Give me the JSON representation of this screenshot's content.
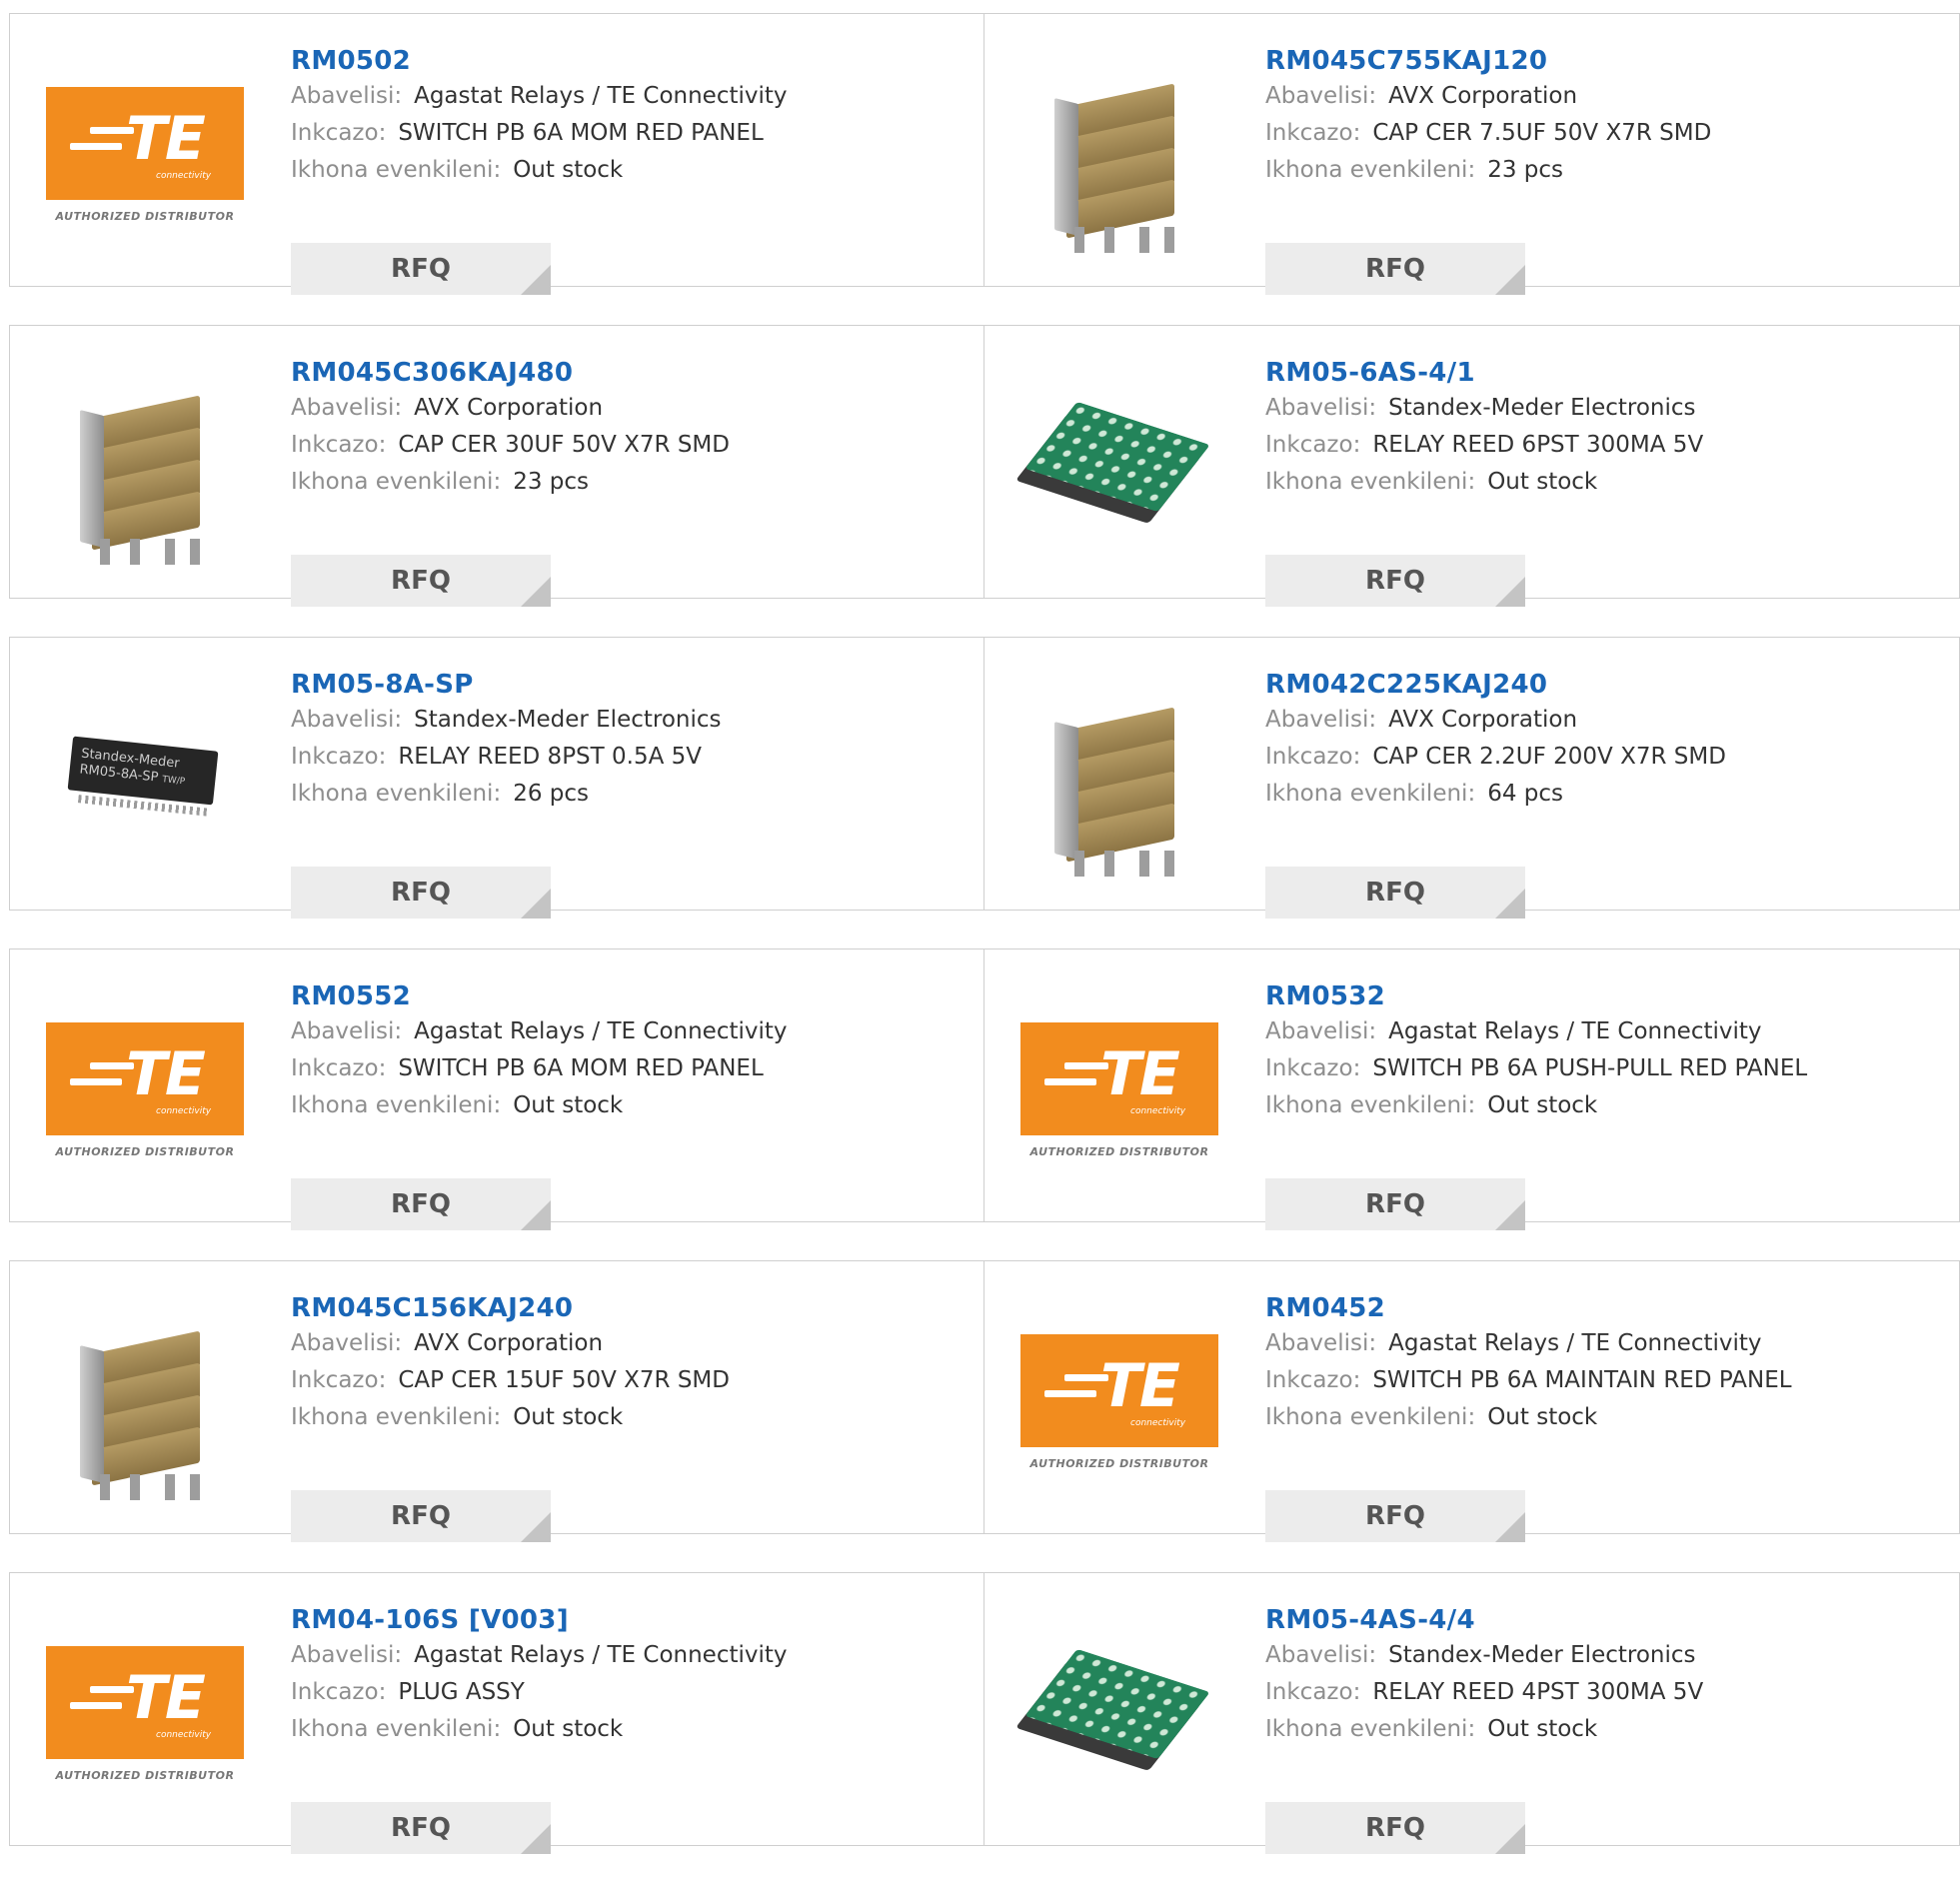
{
  "labels": {
    "manufacturer": "Abavelisi:",
    "description": "Inkcazo:",
    "stock": "Ikhona evenkileni:",
    "rfq": "RFQ"
  },
  "logo": {
    "brand": "TE",
    "sub": "connectivity",
    "tagline": "AUTHORIZED DISTRIBUTOR"
  },
  "sip_marking": [
    "Standex-Meder",
    "RM05-8A-SP",
    "TW/P"
  ],
  "colors": {
    "link": "#1a66b6",
    "te_orange": "#f28c1e",
    "rfq_bg": "#ececec"
  },
  "products": [
    {
      "part": "RM0502",
      "manufacturer": "Agastat Relays / TE Connectivity",
      "description": "SWITCH PB 6A MOM RED PANEL",
      "stock": "Out stock",
      "image": "te-logo"
    },
    {
      "part": "RM045C755KAJ120",
      "manufacturer": "AVX Corporation",
      "description": "CAP CER 7.5UF 50V X7R SMD",
      "stock": "23 pcs",
      "image": "capacitor-stack"
    },
    {
      "part": "RM045C306KAJ480",
      "manufacturer": "AVX Corporation",
      "description": "CAP CER 30UF 50V X7R SMD",
      "stock": "23 pcs",
      "image": "capacitor-stack"
    },
    {
      "part": "RM05-6AS-4/1",
      "manufacturer": "Standex-Meder Electronics",
      "description": "RELAY REED 6PST 300MA 5V",
      "stock": "Out stock",
      "image": "reed-relay"
    },
    {
      "part": "RM05-8A-SP",
      "manufacturer": "Standex-Meder Electronics",
      "description": "RELAY REED 8PST 0.5A 5V",
      "stock": "26 pcs",
      "image": "sip-relay"
    },
    {
      "part": "RM042C225KAJ240",
      "manufacturer": "AVX Corporation",
      "description": "CAP CER 2.2UF 200V X7R SMD",
      "stock": "64 pcs",
      "image": "capacitor-stack"
    },
    {
      "part": "RM0552",
      "manufacturer": "Agastat Relays / TE Connectivity",
      "description": "SWITCH PB 6A MOM RED PANEL",
      "stock": "Out stock",
      "image": "te-logo"
    },
    {
      "part": "RM0532",
      "manufacturer": "Agastat Relays / TE Connectivity",
      "description": "SWITCH PB 6A PUSH-PULL RED PANEL",
      "stock": "Out stock",
      "image": "te-logo"
    },
    {
      "part": "RM045C156KAJ240",
      "manufacturer": "AVX Corporation",
      "description": "CAP CER 15UF 50V X7R SMD",
      "stock": "Out stock",
      "image": "capacitor-stack"
    },
    {
      "part": "RM0452",
      "manufacturer": "Agastat Relays / TE Connectivity",
      "description": "SWITCH PB 6A MAINTAIN RED PANEL",
      "stock": "Out stock",
      "image": "te-logo"
    },
    {
      "part": "RM04-106S [V003]",
      "manufacturer": "Agastat Relays / TE Connectivity",
      "description": "PLUG ASSY",
      "stock": "Out stock",
      "image": "te-logo"
    },
    {
      "part": "RM05-4AS-4/4",
      "manufacturer": "Standex-Meder Electronics",
      "description": "RELAY REED 4PST 300MA 5V",
      "stock": "Out stock",
      "image": "reed-relay"
    }
  ]
}
